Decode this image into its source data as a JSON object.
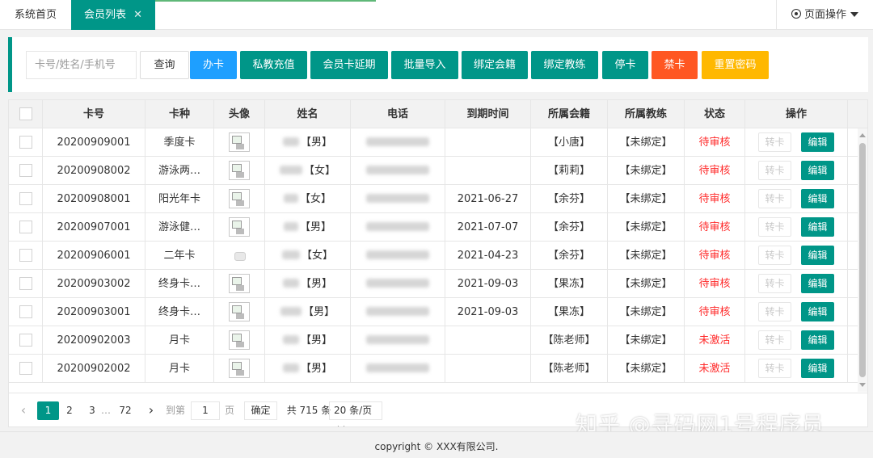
{
  "tabs": {
    "home": "系统首页",
    "active": "会员列表",
    "close_symbol": "✕",
    "page_ops": "页面操作"
  },
  "toolbar": {
    "search_placeholder": "卡号/姓名/手机号",
    "query": "查询",
    "buttons": [
      "办卡",
      "私教充值",
      "会员卡延期",
      "批量导入",
      "绑定会籍",
      "绑定教练",
      "停卡",
      "禁卡",
      "重置密码"
    ],
    "button_colors": {
      "办卡": "#1e9fff",
      "禁卡": "#ff5722",
      "重置密码": "#ffb800",
      "default": "#009688"
    }
  },
  "table": {
    "headers": [
      "卡号",
      "卡种",
      "头像",
      "姓名",
      "电话",
      "到期时间",
      "所属会籍",
      "所属教练",
      "状态",
      "操作"
    ],
    "rows": [
      {
        "card_no": "20200909001",
        "card_type": "季度卡",
        "gender": "【男】",
        "expire": "",
        "membership": "【小唐】",
        "coach": "【未绑定】",
        "status": "待审核"
      },
      {
        "card_no": "20200908002",
        "card_type": "游泳两…",
        "gender": "【女】",
        "expire": "",
        "membership": "【莉莉】",
        "coach": "【未绑定】",
        "status": "待审核"
      },
      {
        "card_no": "20200908001",
        "card_type": "阳光年卡",
        "gender": "【女】",
        "expire": "2021-06-27",
        "membership": "【余芬】",
        "coach": "【未绑定】",
        "status": "待审核"
      },
      {
        "card_no": "20200907001",
        "card_type": "游泳健…",
        "gender": "【男】",
        "expire": "2021-07-07",
        "membership": "【余芬】",
        "coach": "【未绑定】",
        "status": "待审核"
      },
      {
        "card_no": "20200906001",
        "card_type": "二年卡",
        "gender": "【女】",
        "expire": "2021-04-23",
        "membership": "【余芬】",
        "coach": "【未绑定】",
        "status": "待审核"
      },
      {
        "card_no": "20200903002",
        "card_type": "终身卡…",
        "gender": "【男】",
        "expire": "2021-09-03",
        "membership": "【果冻】",
        "coach": "【未绑定】",
        "status": "待审核"
      },
      {
        "card_no": "20200903001",
        "card_type": "终身卡…",
        "gender": "【男】",
        "expire": "2021-09-03",
        "membership": "【果冻】",
        "coach": "【未绑定】",
        "status": "待审核"
      },
      {
        "card_no": "20200902003",
        "card_type": "月卡",
        "gender": "【男】",
        "expire": "",
        "membership": "【陈老师】",
        "coach": "【未绑定】",
        "status": "未激活"
      },
      {
        "card_no": "20200902002",
        "card_type": "月卡",
        "gender": "【男】",
        "expire": "",
        "membership": "【陈老师】",
        "coach": "【未绑定】",
        "status": "未激活"
      }
    ],
    "row_actions": {
      "transfer": "转卡",
      "edit": "编辑"
    }
  },
  "pagination": {
    "pages": [
      "1",
      "2",
      "3",
      "…",
      "72"
    ],
    "current": "1",
    "goto_label": "到第",
    "goto_value": "1",
    "page_suffix": "页",
    "confirm": "确定",
    "total": "共 715 条",
    "page_size": "20 条/页"
  },
  "watermark": "知乎 @寻码网1号程序员",
  "footer": "copyright © XXX有限公司."
}
